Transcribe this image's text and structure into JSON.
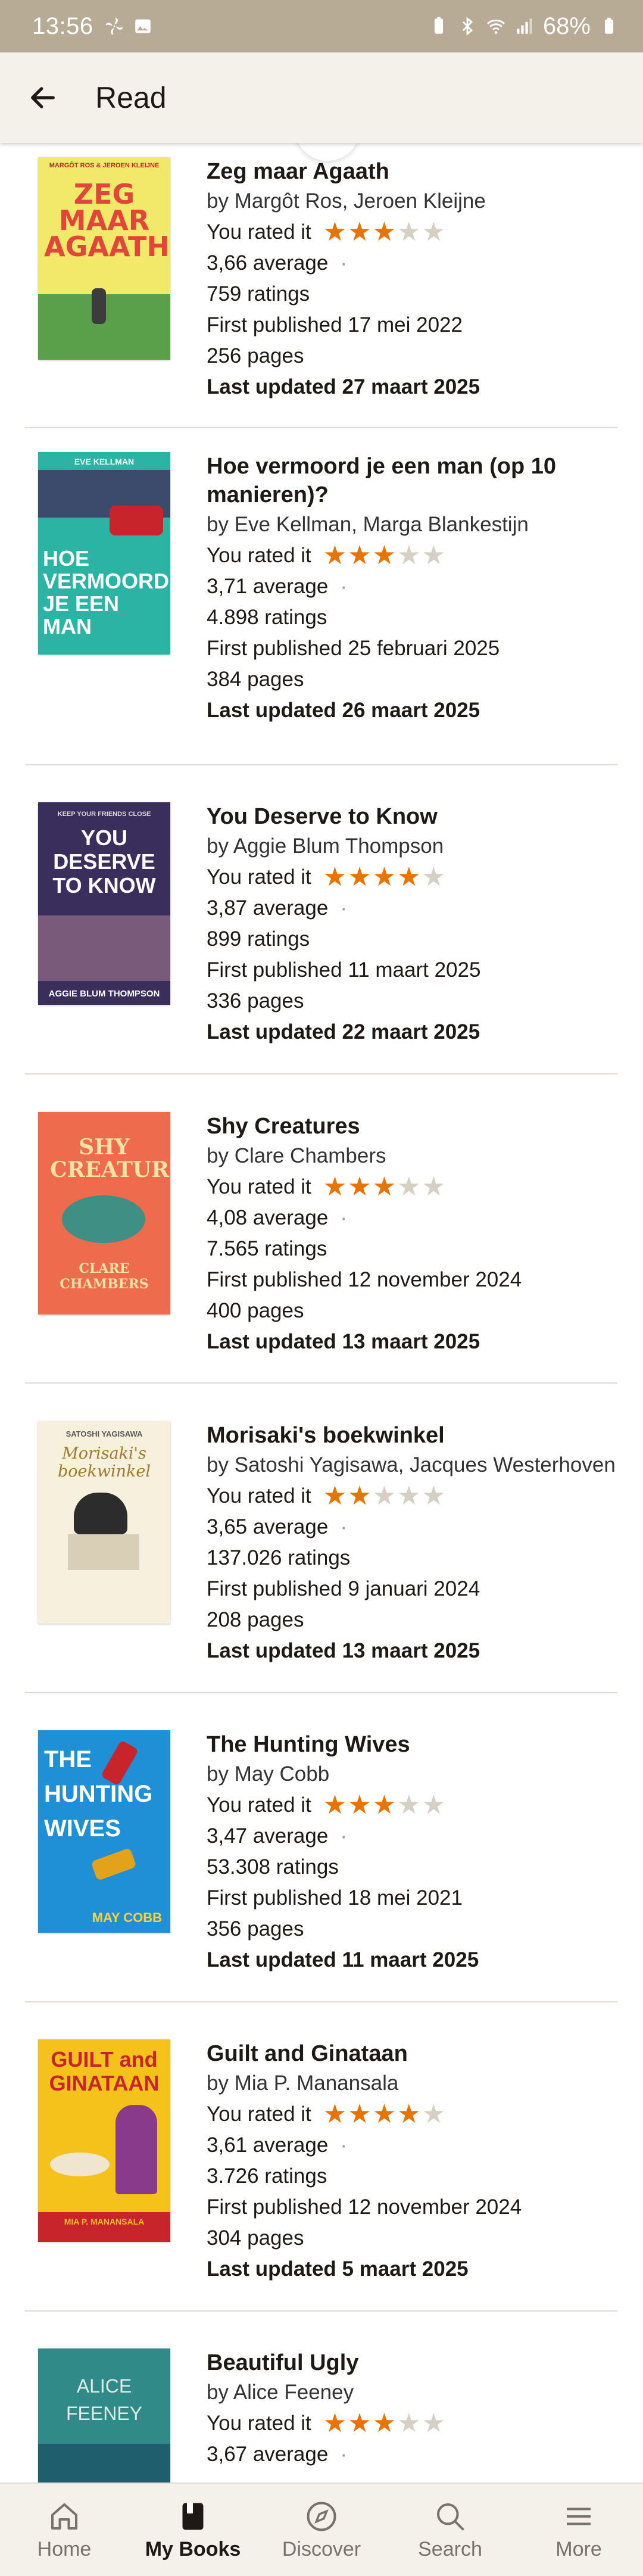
{
  "status_bar": {
    "time": "13:56",
    "battery": "68%"
  },
  "app_bar": {
    "title": "Read"
  },
  "labels": {
    "rated": "You rated it"
  },
  "books": [
    {
      "title": "Zeg maar Agaath",
      "author": "by Margôt Ros, Jeroen Kleijne",
      "rating": 3,
      "average": "3,66 average",
      "ratings": "759 ratings",
      "published": "First published 17 mei 2022",
      "pages": "256 pages",
      "updated": "Last updated 27 maart 2025",
      "cover": {
        "bg": "#f2e96a",
        "accent": "#e2453a",
        "text": "ZEG MAAR AGAATH",
        "top": "MARGÔT ROS & JEROEN KLEIJNE"
      }
    },
    {
      "title": "Hoe vermoord je een man (op 10 manieren)?",
      "author": "by Eve Kellman, Marga Blankestijn",
      "rating": 3,
      "average": "3,71 average",
      "ratings": "4.898 ratings",
      "published": "First published 25 februari 2025",
      "pages": "384 pages",
      "updated": "Last updated 26 maart 2025",
      "cover": {
        "bg": "#2bb3a3",
        "accent": "#c8242b",
        "text": "HOE VERMOORD JE EEN MAN",
        "top": "EVE KELLMAN"
      }
    },
    {
      "title": "You Deserve to Know",
      "author": "by Aggie Blum Thompson",
      "rating": 4,
      "average": "3,87 average",
      "ratings": "899 ratings",
      "published": "First published 11 maart 2025",
      "pages": "336 pages",
      "updated": "Last updated 22 maart 2025",
      "cover": {
        "bg": "#3a2f5c",
        "accent": "#c85a9a",
        "text": "YOU DESERVE TO KNOW",
        "top": "AGGIE BLUM THOMPSON"
      }
    },
    {
      "title": "Shy Creatures",
      "author": "by Clare Chambers",
      "rating": 3,
      "average": "4,08 average",
      "ratings": "7.565 ratings",
      "published": "First published 12 november 2024",
      "pages": "400 pages",
      "updated": "Last updated 13 maart 2025",
      "cover": {
        "bg": "#ee6b4d",
        "accent": "#3f8f84",
        "text": "SHY CREATURES",
        "top": "CLARE CHAMBERS"
      }
    },
    {
      "title": "Morisaki's boekwinkel",
      "author": "by Satoshi Yagisawa, Jacques Westerhoven",
      "rating": 2,
      "average": "3,65 average",
      "ratings": "137.026 ratings",
      "published": "First published 9 januari 2024",
      "pages": "208 pages",
      "updated": "Last updated 13 maart 2025",
      "cover": {
        "bg": "#f7f0dc",
        "accent": "#2c2c2c",
        "text": "Morisaki's boekwinkel",
        "top": "SATOSHI YAGISAWA"
      }
    },
    {
      "title": "The Hunting Wives",
      "author": "by May Cobb",
      "rating": 3,
      "average": "3,47 average",
      "ratings": "53.308 ratings",
      "published": "First published 18 mei 2021",
      "pages": "356 pages",
      "updated": "Last updated 11 maart 2025",
      "cover": {
        "bg": "#1f8fd6",
        "accent": "#c8242b",
        "text": "THE HUNTING WIVES",
        "top": "MAY COBB"
      }
    },
    {
      "title": "Guilt and Ginataan",
      "author": "by Mia P. Manansala",
      "rating": 4,
      "average": "3,61 average",
      "ratings": "3.726 ratings",
      "published": "First published 12 november 2024",
      "pages": "304 pages",
      "updated": "Last updated 5 maart 2025",
      "cover": {
        "bg": "#f4c21a",
        "accent": "#c8242b",
        "text": "GUILT and GINATAAN",
        "top": "MIA P. MANANSALA"
      }
    },
    {
      "title": "Beautiful Ugly",
      "author": "by Alice Feeney",
      "rating": 3,
      "average": "3,67 average",
      "ratings": "",
      "published": "",
      "pages": "",
      "updated": "",
      "cover": {
        "bg": "#2f8a88",
        "accent": "#dfe9e6",
        "text": "ALICE FEENEY",
        "top": ""
      }
    }
  ],
  "bottom_nav": [
    {
      "label": "Home",
      "icon": "home-icon",
      "active": false
    },
    {
      "label": "My Books",
      "icon": "book-icon",
      "active": true
    },
    {
      "label": "Discover",
      "icon": "compass-icon",
      "active": false
    },
    {
      "label": "Search",
      "icon": "search-icon",
      "active": false
    },
    {
      "label": "More",
      "icon": "menu-icon",
      "active": false
    }
  ]
}
